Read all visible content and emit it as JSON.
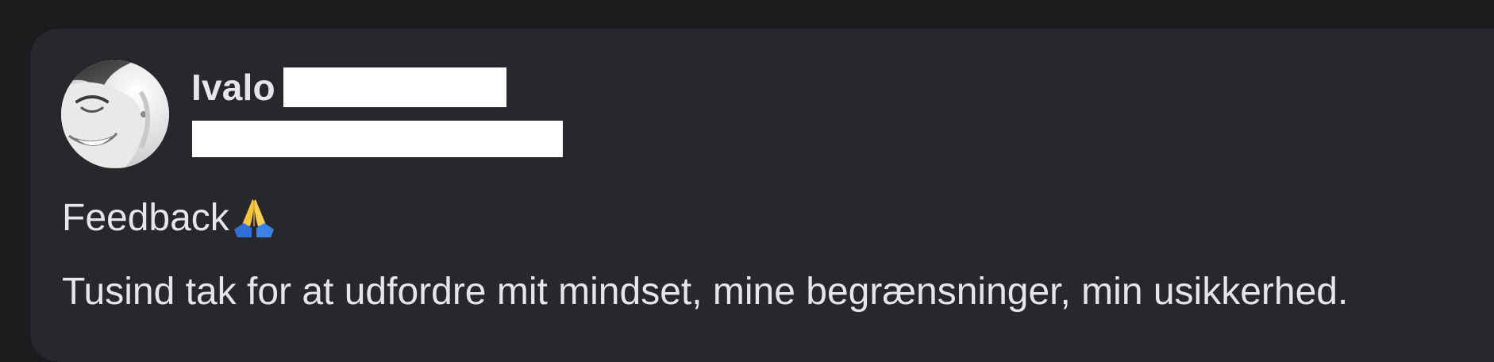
{
  "post": {
    "author": {
      "first_name": "Ivalo",
      "avatar_icon": "profile-photo"
    },
    "title": "Feedback",
    "title_emoji": "folded-hands-icon",
    "body": "Tusind tak for at udfordre mit mindset, mine begrænsninger, min usikkerhed."
  },
  "colors": {
    "page_background": "#1c1c1e",
    "card_background": "#27282b",
    "text": "#e6e6ea",
    "redaction": "#ffffff"
  }
}
